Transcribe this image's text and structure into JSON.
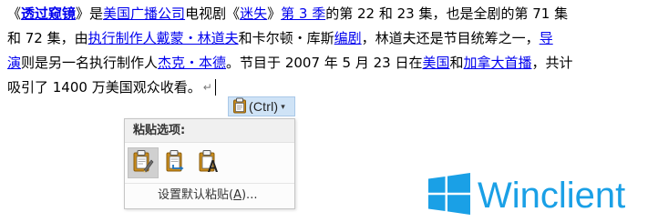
{
  "document": {
    "line1": {
      "t1": "《",
      "link_show": "透过窥镜",
      "t2": "》是",
      "link_abc": "美国广播公司",
      "t3": "电视剧《",
      "link_lost": "迷失",
      "t4": "》",
      "link_season3": "第 3 季",
      "t5": "的第 22 和 23 集，也是全剧的第 71 集"
    },
    "line2": {
      "t1": "和 72 集，由",
      "link_producer": "执行制作人戴蒙・林道夫",
      "t2": "和卡尔顿・库斯",
      "link_writer": "编剧",
      "t3": "，林道夫还是节目统筹之一，",
      "link_director_a": "导"
    },
    "line3": {
      "link_director_b": "演",
      "t1": "则是另一名执行制作人",
      "link_jack": "杰克・本德",
      "t2": "。节目于 2007 年 5 月 23 日在",
      "link_usa": "美国",
      "t3": "和",
      "link_canada": "加拿大首播",
      "t4": "，共计"
    },
    "line4": {
      "t1": "吸引了 1400 万美国观众收看。",
      "paragraph_mark": "↵"
    }
  },
  "paste_trigger": {
    "label": "(Ctrl)",
    "icon": "clipboard-icon",
    "arrow": "▾"
  },
  "paste_menu": {
    "header": "粘贴选项:",
    "options": [
      {
        "icon": "keep-source-formatting-icon",
        "selected": true
      },
      {
        "icon": "merge-formatting-icon",
        "selected": false
      },
      {
        "icon": "keep-text-only-icon",
        "selected": false
      }
    ],
    "default_item": {
      "prefix": "设置默认粘贴(",
      "accelerator": "A",
      "suffix": ")..."
    }
  },
  "watermark": {
    "text": "Winclient",
    "icon": "windows-logo-icon"
  },
  "colors": {
    "link": "#0000ee",
    "trigger_bg": "#cfe3f6",
    "selected_bg": "#d0d0d0",
    "watermark": "#1aa0e6",
    "clipboard": "#c98b1a"
  }
}
